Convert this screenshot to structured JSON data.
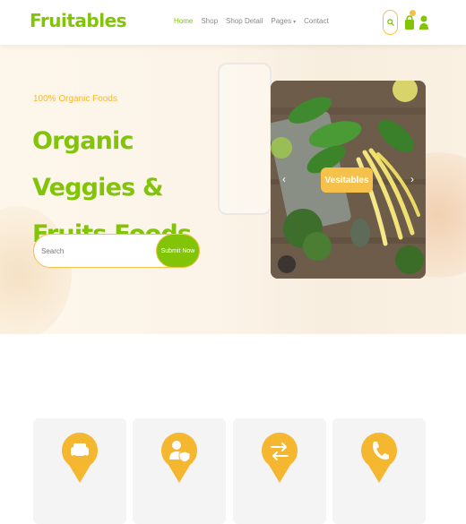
{
  "brand": {
    "logo": "Fruitables",
    "accent": "#81c408",
    "secondary": "#f5c14b"
  },
  "nav": {
    "links": [
      {
        "label": "Home",
        "active": true
      },
      {
        "label": "Shop",
        "active": false
      },
      {
        "label": "Shop Detail",
        "active": false
      },
      {
        "label": "Pages",
        "active": false,
        "has_dropdown": true
      },
      {
        "label": "Contact",
        "active": false
      }
    ],
    "icons": [
      "search-icon",
      "shopping-bag-icon",
      "user-icon"
    ]
  },
  "hero": {
    "tagline": "100% Organic Foods",
    "title": "Organic Veggies & Fruits Foods",
    "search_placeholder": "Search",
    "submit_label": "Submit Now",
    "carousel_label": "Vesitables"
  },
  "features": {
    "icons": [
      "car-icon",
      "user-shield-icon",
      "exchange-icon",
      "phone-icon"
    ]
  }
}
